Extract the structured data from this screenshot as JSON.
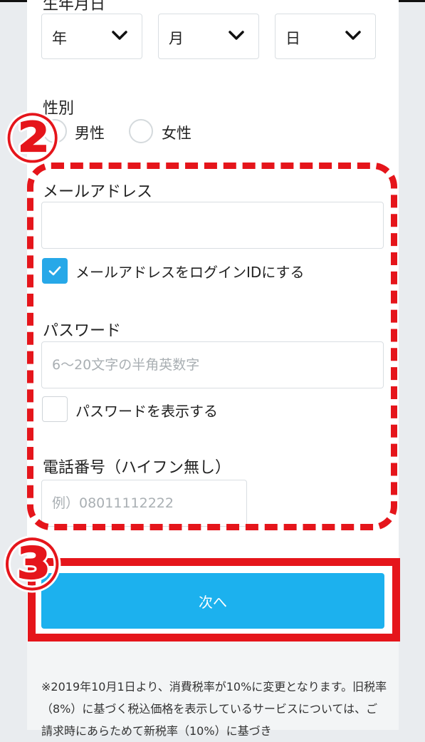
{
  "birthdate": {
    "label": "生年月日",
    "year": "年",
    "month": "月",
    "day": "日"
  },
  "gender": {
    "label": "性別",
    "male": "男性",
    "female": "女性"
  },
  "email": {
    "label": "メールアドレス",
    "value": "",
    "use_as_login_label": "メールアドレスをログインIDにする",
    "use_as_login_checked": true
  },
  "password": {
    "label": "パスワード",
    "placeholder": "6〜20文字の半角英数字",
    "show_label": "パスワードを表示する",
    "show_checked": false
  },
  "phone": {
    "label": "電話番号（ハイフン無し）",
    "placeholder": "例）08011112222"
  },
  "next_button": "次へ",
  "annotations": {
    "marker_2": "②",
    "marker_3": "③",
    "color": "#e5151b"
  },
  "notice": "※2019年10月1日より、消費税率が10%に変更となります。旧税率（8%）に基づく税込価格を表示しているサービスについては、ご請求時にあらためて新税率（10%）に基づき"
}
